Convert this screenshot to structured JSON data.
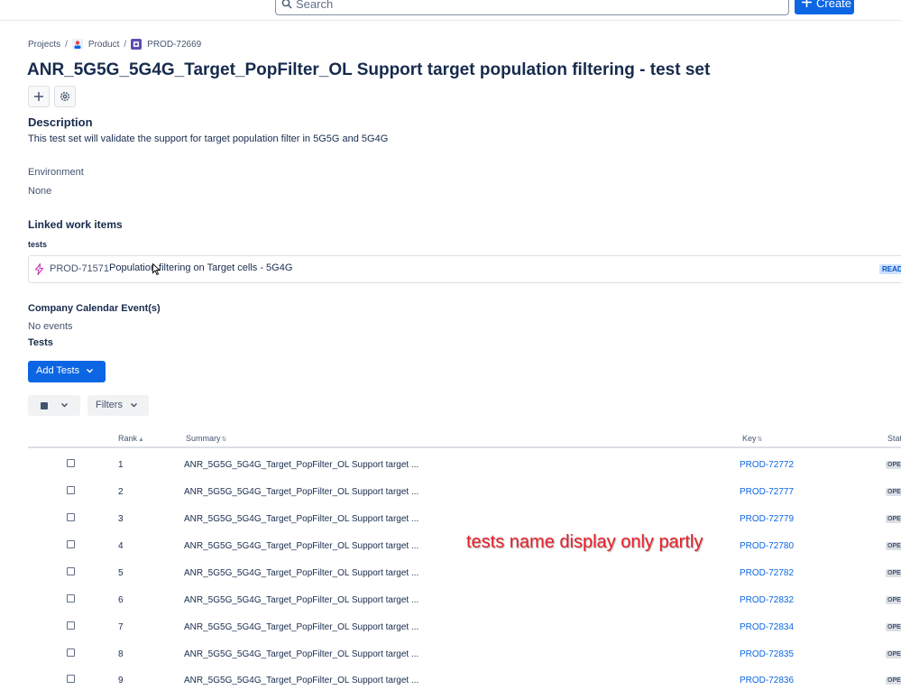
{
  "topbar": {
    "search_placeholder": "Search",
    "create_label": "Create",
    "accent": "#0c66e4"
  },
  "breadcrumb": {
    "items": [
      "Projects",
      "Product",
      "PROD-72669"
    ]
  },
  "issue": {
    "title": "ANR_5G5G_5G4G_Target_PopFilter_OL Support target population filtering - test set",
    "description_heading": "Description",
    "description_text": "This test set will validate the support for target population filter in 5G5G and 5G4G",
    "environment_heading": "Environment",
    "environment_value": "None",
    "linked_heading": "Linked work items",
    "linked_relation": "tests",
    "linked_item": {
      "key": "PROD-71571",
      "summary": "Population filtering on Target cells - 5G4G",
      "status": "READ",
      "icon": "lightning-icon"
    },
    "calendar_heading": "Company Calendar Event(s)",
    "calendar_value": "No events",
    "tests_heading": "Tests"
  },
  "toolbar": {
    "add_tests_label": "Add Tests",
    "filters_label": "Filters"
  },
  "table": {
    "columns": [
      "Rank",
      "Summary",
      "Key",
      "Stat"
    ],
    "rows": [
      {
        "rank": "1",
        "summary": "ANR_5G5G_5G4G_Target_PopFilter_OL Support target ...",
        "key": "PROD-72772",
        "status": "OPE"
      },
      {
        "rank": "2",
        "summary": "ANR_5G5G_5G4G_Target_PopFilter_OL Support target ...",
        "key": "PROD-72777",
        "status": "OPE"
      },
      {
        "rank": "3",
        "summary": "ANR_5G5G_5G4G_Target_PopFilter_OL Support target ...",
        "key": "PROD-72779",
        "status": "OPE"
      },
      {
        "rank": "4",
        "summary": "ANR_5G5G_5G4G_Target_PopFilter_OL Support target ...",
        "key": "PROD-72780",
        "status": "OPE"
      },
      {
        "rank": "5",
        "summary": "ANR_5G5G_5G4G_Target_PopFilter_OL Support target ...",
        "key": "PROD-72782",
        "status": "OPE"
      },
      {
        "rank": "6",
        "summary": "ANR_5G5G_5G4G_Target_PopFilter_OL Support target ...",
        "key": "PROD-72832",
        "status": "OPE"
      },
      {
        "rank": "7",
        "summary": "ANR_5G5G_5G4G_Target_PopFilter_OL Support target ...",
        "key": "PROD-72834",
        "status": "OPE"
      },
      {
        "rank": "8",
        "summary": "ANR_5G5G_5G4G_Target_PopFilter_OL Support target ...",
        "key": "PROD-72835",
        "status": "OPE"
      },
      {
        "rank": "9",
        "summary": "ANR_5G5G_5G4G_Target_PopFilter_OL Support target ...",
        "key": "PROD-72836",
        "status": "OPE"
      }
    ]
  },
  "annotation": {
    "text": "tests name display only partly",
    "color": "#e8202a"
  }
}
